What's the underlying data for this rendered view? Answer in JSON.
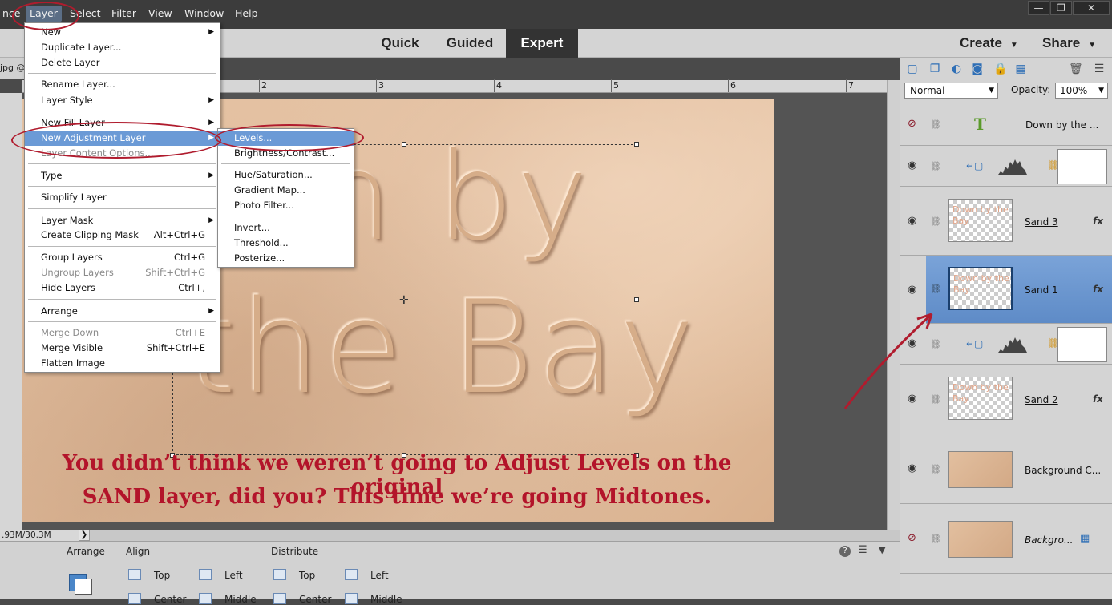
{
  "menubar": {
    "partial_left": "nce",
    "items": [
      "Layer",
      "Select",
      "Filter",
      "View",
      "Window",
      "Help"
    ],
    "active": "Layer",
    "window_controls": [
      "—",
      "❐",
      "✕"
    ]
  },
  "modebar": {
    "tabs": [
      "Quick",
      "Guided",
      "Expert"
    ],
    "active": "Expert",
    "create": "Create",
    "share": "Share"
  },
  "document": {
    "tab_label": "jpg @",
    "status": ".93M/30.3M",
    "ruler_ticks": [
      "2",
      "3",
      "4",
      "5",
      "6",
      "7"
    ]
  },
  "canvas": {
    "sand_line1": "wn by",
    "sand_line2": "the Bay",
    "caption_line1": "You didn’t think we weren’t going to Adjust Levels on the original",
    "caption_line2": "SAND layer, did you? This time we’re going Midtones."
  },
  "layer_menu": {
    "items": [
      {
        "label": "New",
        "submenu": true
      },
      {
        "label": "Duplicate Layer..."
      },
      {
        "label": "Delete Layer"
      },
      {
        "label": "Rename Layer..."
      },
      {
        "label": "Layer Style",
        "submenu": true
      },
      {
        "label": "New Fill Layer",
        "submenu": true
      },
      {
        "label": "New Adjustment Layer",
        "submenu": true,
        "highlighted": true
      },
      {
        "label": "Layer Content Options...",
        "disabled": true
      },
      {
        "label": "Type",
        "submenu": true
      },
      {
        "label": "Simplify Layer"
      },
      {
        "label": "Layer Mask",
        "submenu": true
      },
      {
        "label": "Create Clipping Mask",
        "shortcut": "Alt+Ctrl+G"
      },
      {
        "label": "Group Layers",
        "shortcut": "Ctrl+G"
      },
      {
        "label": "Ungroup Layers",
        "shortcut": "Shift+Ctrl+G",
        "disabled": true
      },
      {
        "label": "Hide Layers",
        "shortcut": "Ctrl+,"
      },
      {
        "label": "Arrange",
        "submenu": true
      },
      {
        "label": "Merge Down",
        "shortcut": "Ctrl+E",
        "disabled": true
      },
      {
        "label": "Merge Visible",
        "shortcut": "Shift+Ctrl+E"
      },
      {
        "label": "Flatten Image"
      }
    ]
  },
  "adjustment_submenu": {
    "items": [
      "Levels...",
      "Brightness/Contrast...",
      "Hue/Saturation...",
      "Gradient Map...",
      "Photo Filter...",
      "Invert...",
      "Threshold...",
      "Posterize..."
    ],
    "highlighted": "Levels..."
  },
  "layers_panel": {
    "blend_mode": "Normal",
    "opacity_label": "Opacity:",
    "opacity_value": "100%",
    "layers": [
      {
        "name": "Down by the ...",
        "kind": "text",
        "visible": false
      },
      {
        "name": "",
        "kind": "adjustment",
        "visible": true
      },
      {
        "name": "Sand 3",
        "kind": "pixel",
        "visible": true,
        "fx": "fx"
      },
      {
        "name": "Sand 1",
        "kind": "pixel",
        "visible": true,
        "fx": "fx",
        "selected": true
      },
      {
        "name": "",
        "kind": "adjustment",
        "visible": true
      },
      {
        "name": "Sand 2",
        "kind": "pixel",
        "visible": true,
        "fx": "fx"
      },
      {
        "name": "Background C...",
        "kind": "sand",
        "visible": true
      },
      {
        "name": "Backgro...",
        "kind": "sand",
        "visible": false
      }
    ],
    "thumb_text": "Down by the Bay"
  },
  "options_bar": {
    "arrange": "Arrange",
    "align": "Align",
    "distribute": "Distribute",
    "align_items": [
      "Top",
      "Left",
      "Center",
      "Middle"
    ],
    "distribute_items": [
      "Top",
      "Left",
      "Center",
      "Middle"
    ]
  },
  "colors": {
    "annotation_red": "#b01c2e",
    "caption_red": "#b3142a",
    "menu_highlight": "#6b9ad6",
    "selected_layer": "#5e8bc7"
  }
}
